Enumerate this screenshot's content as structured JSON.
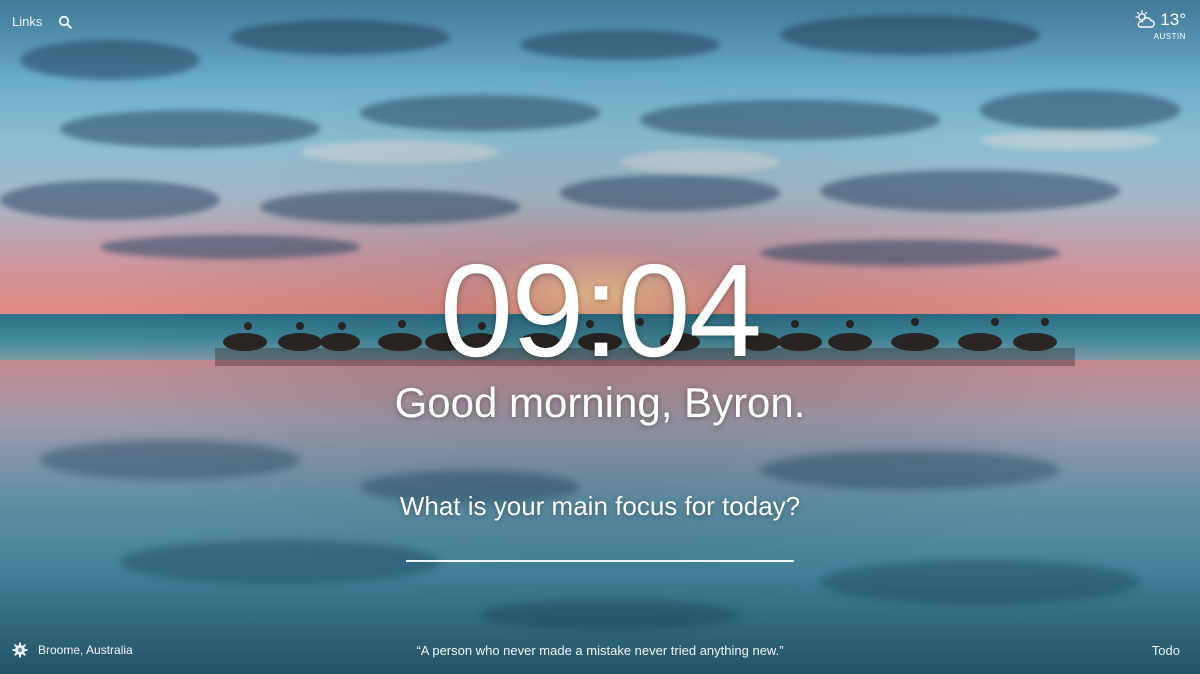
{
  "top_bar": {
    "links_label": "Links",
    "search_icon": "search-icon"
  },
  "weather": {
    "icon": "partly-cloudy-icon",
    "temperature": "13°",
    "location": "AUSTIN"
  },
  "main": {
    "clock": "09:04",
    "greeting": "Good morning, Byron.",
    "focus_prompt": "What is your main focus for today?",
    "focus_value": ""
  },
  "bottom_bar": {
    "settings_icon": "gear-icon",
    "photo_location": "Broome, Australia",
    "quote": "“A person who never made a mistake never tried anything new.”",
    "todo_label": "Todo"
  }
}
